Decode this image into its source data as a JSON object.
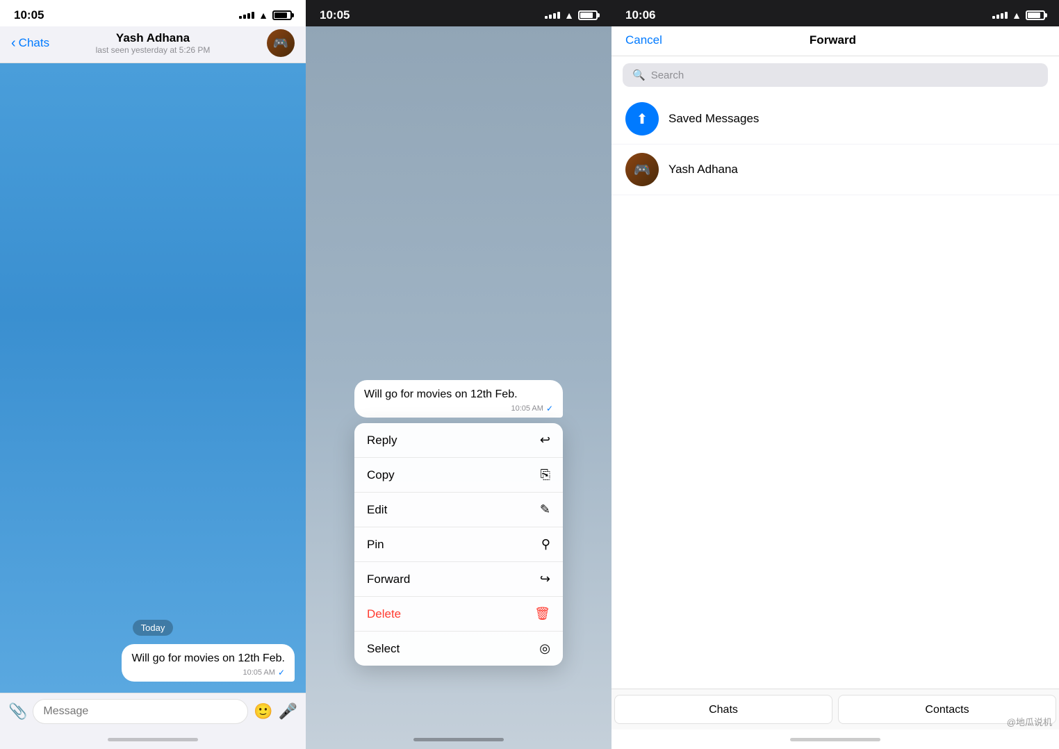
{
  "panel1": {
    "status": {
      "time": "10:05"
    },
    "nav": {
      "back_label": "Chats",
      "contact_name": "Yash Adhana",
      "last_seen": "last seen yesterday at 5:26 PM"
    },
    "chat": {
      "date_badge": "Today",
      "message_text": "Will go for movies on 12th Feb.",
      "message_time": "10:05 AM",
      "message_check": "✓"
    },
    "input": {
      "placeholder": "Message"
    }
  },
  "panel2": {
    "status": {
      "time": "10:05"
    },
    "message": {
      "text": "Will go for movies on 12th Feb.",
      "time": "10:05 AM",
      "check": "✓"
    },
    "context_menu": {
      "items": [
        {
          "label": "Reply",
          "icon": "↩",
          "color": "normal"
        },
        {
          "label": "Copy",
          "icon": "⎘",
          "color": "normal"
        },
        {
          "label": "Edit",
          "icon": "✎",
          "color": "normal"
        },
        {
          "label": "Pin",
          "icon": "⚲",
          "color": "normal"
        },
        {
          "label": "Forward",
          "icon": "↪",
          "color": "normal"
        },
        {
          "label": "Delete",
          "icon": "🗑",
          "color": "red"
        },
        {
          "label": "Select",
          "icon": "◎",
          "color": "normal"
        }
      ]
    }
  },
  "panel3": {
    "status": {
      "time": "10:06"
    },
    "nav": {
      "cancel_label": "Cancel",
      "title": "Forward"
    },
    "search": {
      "placeholder": "Search"
    },
    "contacts": [
      {
        "name": "Saved Messages",
        "type": "saved"
      },
      {
        "name": "Yash Adhana",
        "type": "yash"
      }
    ],
    "bottom_tabs": [
      {
        "label": "Chats"
      },
      {
        "label": "Contacts"
      }
    ],
    "watermark": "@地瓜说机"
  }
}
